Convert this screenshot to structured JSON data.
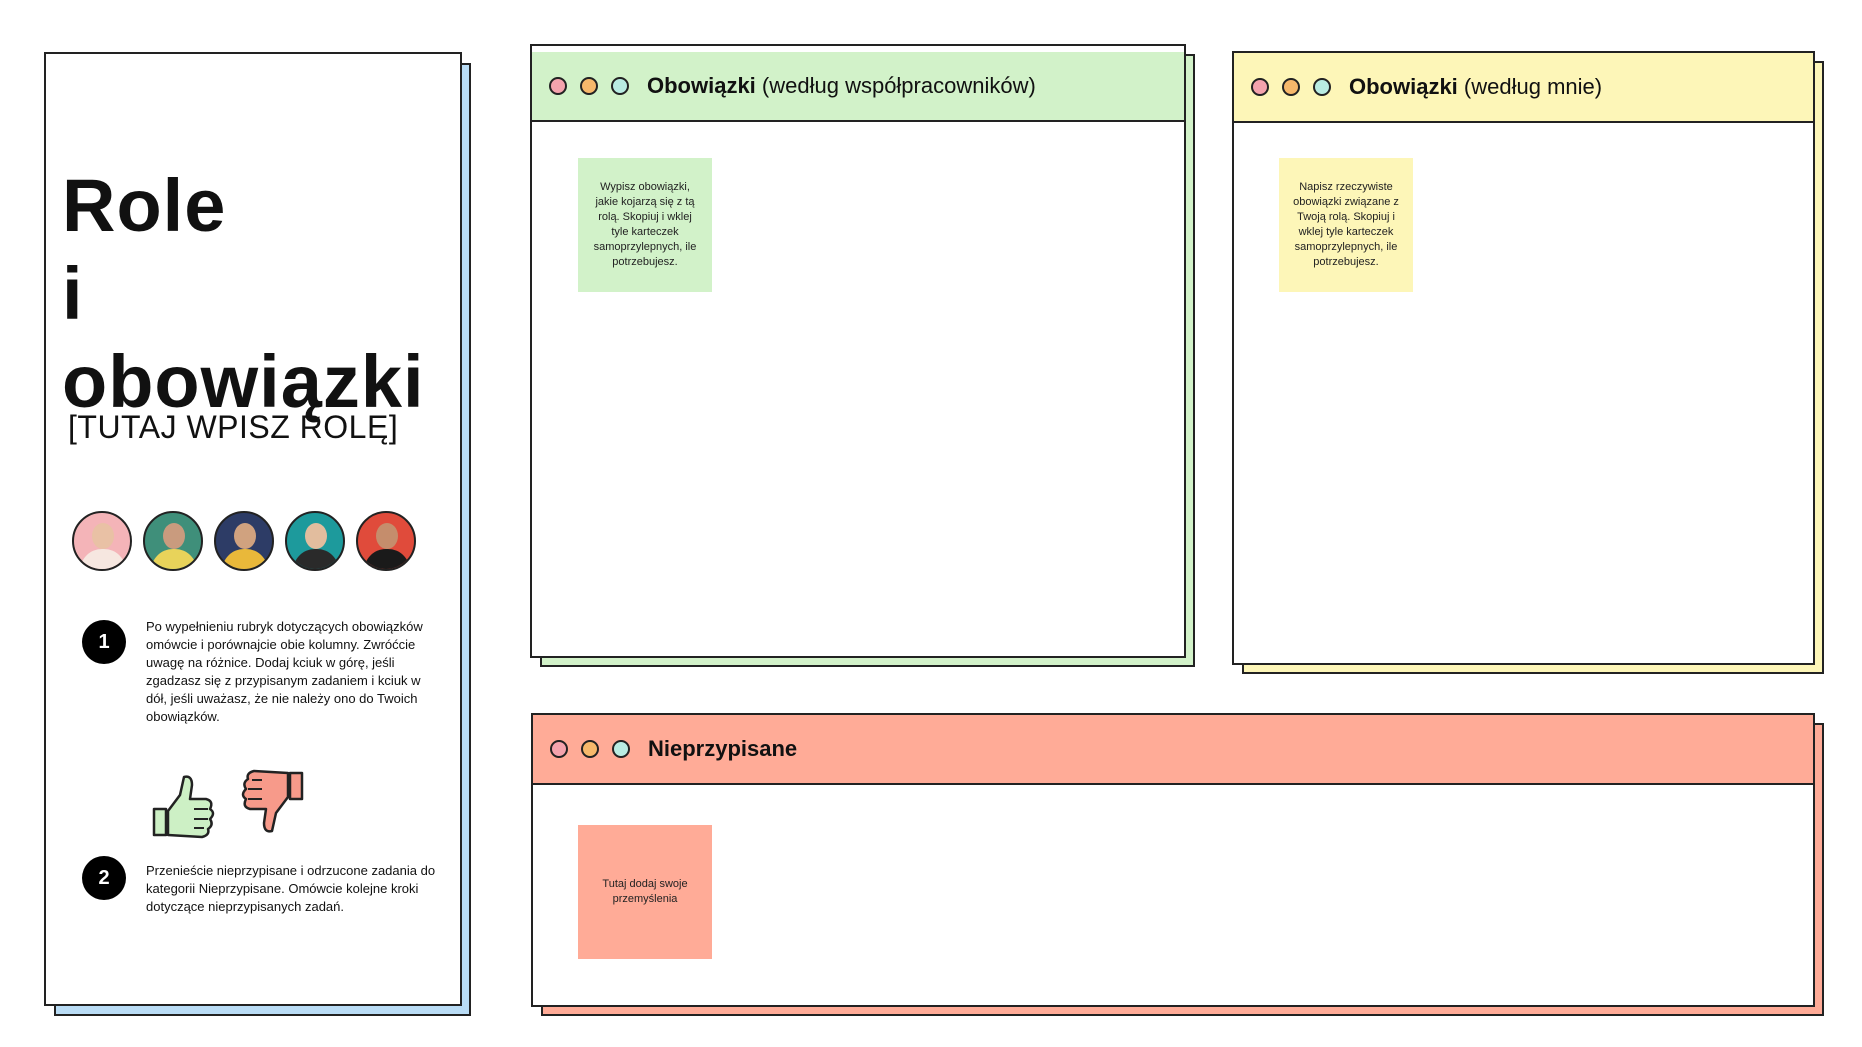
{
  "left": {
    "title_line1": "Role",
    "title_line2": "i obowiązki",
    "role_placeholder": "[TUTAJ WPISZ ROLĘ]",
    "avatars": [
      {
        "bg": "#f4b4b8",
        "skin": "#e9c1a5",
        "cloth": "#f6e7e0"
      },
      {
        "bg": "#3f8f7a",
        "skin": "#c99b7e",
        "cloth": "#e8d35a"
      },
      {
        "bg": "#2d3c66",
        "skin": "#d0a27f",
        "cloth": "#e9b83a"
      },
      {
        "bg": "#1d9a9c",
        "skin": "#e2bd9e",
        "cloth": "#2a2a2a"
      },
      {
        "bg": "#e04b3b",
        "skin": "#c58d6c",
        "cloth": "#1a1a1a"
      }
    ],
    "step1_number": "1",
    "step1_text": "Po wypełnieniu rubryk dotyczących obowiązków omówcie i porównajcie obie kolumny. Zwróćcie uwagę na różnice. Dodaj kciuk w górę, jeśli zgadzasz się z przypisanym zadaniem i kciuk w dół, jeśli uważasz, że nie należy ono do Twoich obowiązków.",
    "step2_number": "2",
    "step2_text": "Przenieście nieprzypisane i odrzucone zadania do kategorii Nieprzypisane. Omówcie kolejne kroki dotyczące nieprzypisanych zadań.",
    "thumbs_up_color": "#cdf0c5",
    "thumbs_down_color": "#f79a8a",
    "accent_shadow": "#b9dcf5"
  },
  "panel_coworkers": {
    "title_bold": "Obowiązki",
    "title_rest": " (według współpracowników)",
    "header_color": "#d2f2c9",
    "sticky_text": "Wypisz obowiązki, jakie kojarzą się z tą rolą. Skopiuj i wklej tyle karteczek samoprzylepnych, ile potrzebujesz.",
    "sticky_color": "#d2f2c9"
  },
  "panel_me": {
    "title_bold": "Obowiązki",
    "title_rest": " (według mnie)",
    "header_color": "#fdf6b8",
    "sticky_text": "Napisz rzeczywiste obowiązki związane z Twoją rolą. Skopiuj i wklej tyle karteczek samoprzylepnych, ile potrzebujesz.",
    "sticky_color": "#fdf6b8"
  },
  "panel_unassigned": {
    "title_bold": "Nieprzypisane",
    "header_color": "#ffab97",
    "sticky_text": "Tutaj dodaj swoje przemyślenia",
    "sticky_color": "#ffab97"
  },
  "dot_colors": [
    "#f4a3ad",
    "#f6b86b",
    "#b9ece2"
  ]
}
